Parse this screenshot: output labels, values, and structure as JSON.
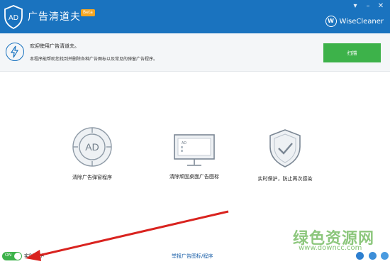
{
  "titlebar": {
    "app_title": "广告清道夫",
    "badge": "Beta",
    "brand_name": "WiseCleaner",
    "brand_mark": "W",
    "window_buttons": [
      "▾",
      "–",
      "✕"
    ]
  },
  "logo_text": "AD",
  "info": {
    "welcome": "欢迎使用广告清道夫。",
    "description": "本程序能帮助您找到并删除各种广告图标以及常见的弹窗广告程序。",
    "scan_button": "扫描"
  },
  "features": [
    {
      "label": "清除广告弹窗程序",
      "icon": "ad-circle-icon",
      "icon_text": "AD"
    },
    {
      "label": "清除顽固桌面广告图标",
      "icon": "monitor-ad-icon",
      "icon_text": "AD"
    },
    {
      "label": "实时保护，防止再次感染",
      "icon": "shield-check-icon"
    }
  ],
  "bottom": {
    "toggle_label": "ON",
    "realtime_label": "实时保护",
    "report_link": "举报广告图标/程序"
  },
  "watermark": {
    "top": "绿色资源网",
    "bottom": "www.downcc.com"
  },
  "colors": {
    "titlebar": "#1a73bf",
    "scan_button": "#3db24a",
    "toggle_on": "#3db24a"
  }
}
